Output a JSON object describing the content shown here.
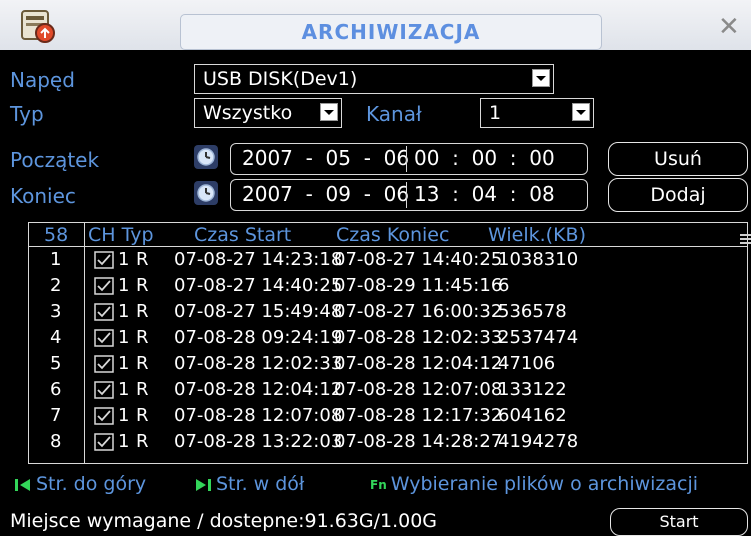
{
  "window": {
    "title": "ARCHIWIZACJA"
  },
  "form": {
    "drive_label": "Napęd",
    "drive_value": "USB DISK(Dev1)",
    "type_label": "Typ",
    "type_value": "Wszystko",
    "channel_label": "Kanał",
    "channel_value": "1",
    "start_label": "Początek",
    "start_date": "2007  -  05  -  06",
    "start_time": "00  :  00  :  00",
    "end_label": "Koniec",
    "end_date": "2007  -  09  -  06",
    "end_time": "13  :  04  :  08",
    "delete_button": "Usuń",
    "add_button": "Dodaj"
  },
  "table": {
    "count": "58",
    "headers": {
      "ch_type": "CH Typ",
      "start": "Czas Start",
      "end": "Czas Koniec",
      "size": "Wielk.(KB)"
    },
    "rows": [
      {
        "n": "1",
        "ch": "1",
        "t": "R",
        "start": "07-08-27 14:23:18",
        "end": "07-08-27 14:40:25",
        "size": "1038310"
      },
      {
        "n": "2",
        "ch": "1",
        "t": "R",
        "start": "07-08-27 14:40:25",
        "end": "07-08-29 11:45:16",
        "size": "6"
      },
      {
        "n": "3",
        "ch": "1",
        "t": "R",
        "start": "07-08-27 15:49:48",
        "end": "07-08-27 16:00:32",
        "size": "536578"
      },
      {
        "n": "4",
        "ch": "1",
        "t": "R",
        "start": "07-08-28 09:24:19",
        "end": "07-08-28 12:02:33",
        "size": "2537474"
      },
      {
        "n": "5",
        "ch": "1",
        "t": "R",
        "start": "07-08-28 12:02:33",
        "end": "07-08-28 12:04:12",
        "size": "47106"
      },
      {
        "n": "6",
        "ch": "1",
        "t": "R",
        "start": "07-08-28 12:04:12",
        "end": "07-08-28 12:07:08",
        "size": "133122"
      },
      {
        "n": "7",
        "ch": "1",
        "t": "R",
        "start": "07-08-28 12:07:08",
        "end": "07-08-28 12:17:32",
        "size": "604162"
      },
      {
        "n": "8",
        "ch": "1",
        "t": "R",
        "start": "07-08-28 13:22:03",
        "end": "07-08-28 14:28:27",
        "size": "4194278"
      }
    ]
  },
  "legend": {
    "page_up": "Str. do góry",
    "page_down": "Str. w dół",
    "fn_select": "Wybieranie plików o archiwizacji",
    "fn_key": "Fn"
  },
  "footer": {
    "space_text": "Miejsce wymagane / dostepne:91.63G/1.00G",
    "start_button": "Start"
  },
  "colors": {
    "label_blue": "#5d95dd",
    "title_blue": "#5d8fe0",
    "legend_green": "#33d65a"
  }
}
